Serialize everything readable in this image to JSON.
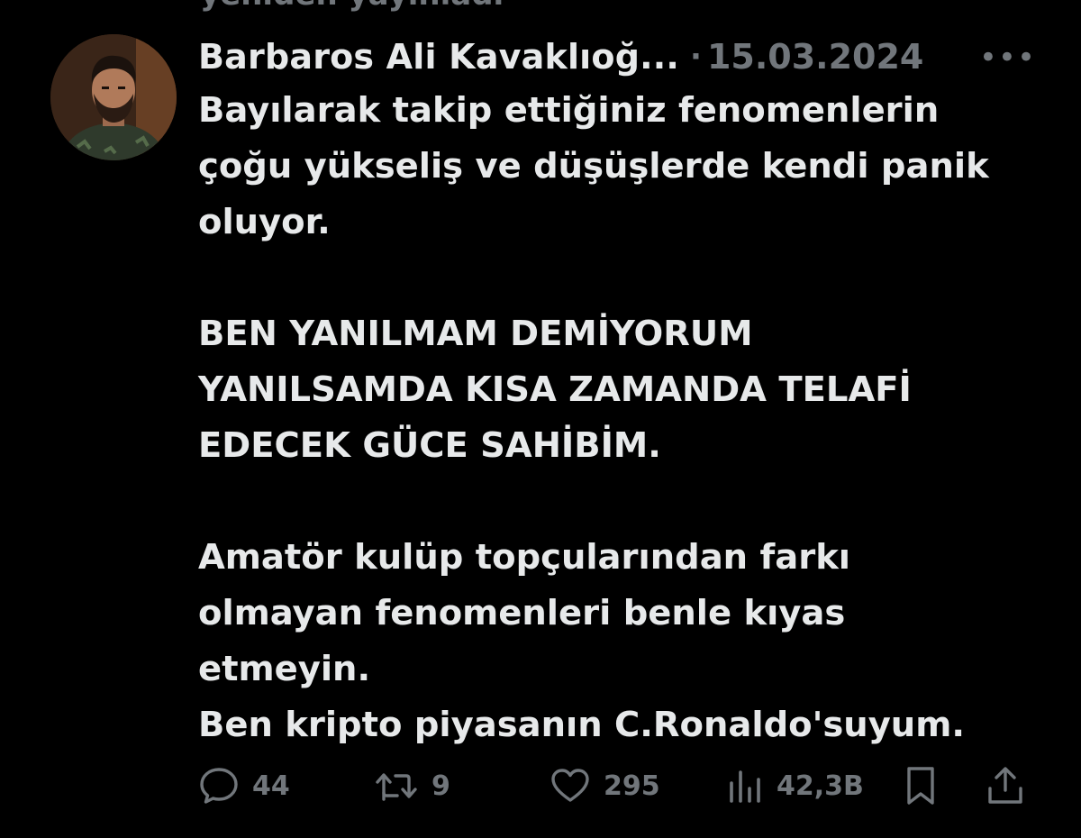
{
  "retweet_context": "yeniden yayınladı",
  "author": {
    "name": "Barbaros Ali Kavaklıoğ...",
    "date": "15.03.2024",
    "more_label": "•••"
  },
  "tweet": {
    "lines": [
      "Bayılarak takip ettiğiniz fenomenlerin",
      "çoğu yükseliş ve düşüşlerde kendi panik",
      "oluyor.",
      "",
      "BEN YANILMAM DEMİYORUM",
      "YANILSAMDA KISA ZAMANDA TELAFİ",
      "EDECEK GÜCE SAHİBİM.",
      "",
      "Amatör kulüp topçularından farkı",
      "olmayan fenomenleri benle kıyas",
      "etmeyin.",
      "Ben kripto piyasanın C.Ronaldo'suyum."
    ]
  },
  "actions": {
    "reply": {
      "icon": "reply-icon",
      "count": "44"
    },
    "retweet": {
      "icon": "retweet-icon",
      "count": "9"
    },
    "like": {
      "icon": "heart-icon",
      "count": "295"
    },
    "views": {
      "icon": "views-chart-icon",
      "count": "42,3B"
    },
    "bookmark": {
      "icon": "bookmark-icon"
    },
    "share": {
      "icon": "share-icon"
    }
  },
  "colors": {
    "background": "#000000",
    "text_primary": "#e7e9ea",
    "text_secondary": "#71767b"
  }
}
